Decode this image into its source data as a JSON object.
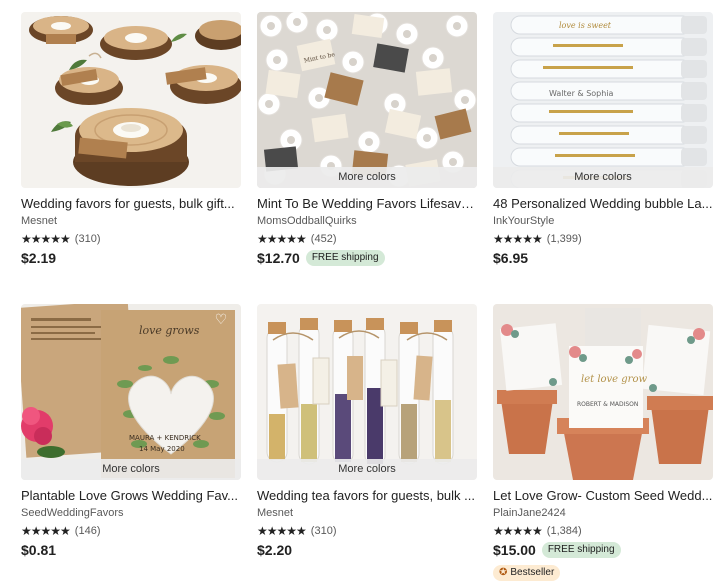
{
  "listings": [
    {
      "title": "Wedding favors for guests, bulk gift...",
      "shop": "Mesnet",
      "stars": "★★★★★",
      "reviews": "(310)",
      "price": "$2.19",
      "more_colors": "",
      "shipping": "",
      "badge": ""
    },
    {
      "title": "Mint To Be Wedding Favors Lifesave...",
      "shop": "MomsOddballQuirks",
      "stars": "★★★★★",
      "reviews": "(452)",
      "price": "$12.70",
      "more_colors": "More colors",
      "shipping": "FREE shipping",
      "badge": ""
    },
    {
      "title": "48 Personalized Wedding bubble La...",
      "shop": "InkYourStyle",
      "stars": "★★★★★",
      "reviews": "(1,399)",
      "price": "$6.95",
      "more_colors": "More colors",
      "shipping": "",
      "badge": ""
    },
    {
      "title": "Plantable Love Grows Wedding Fav...",
      "shop": "SeedWeddingFavors",
      "stars": "★★★★★",
      "reviews": "(146)",
      "price": "$0.81",
      "more_colors": "More colors",
      "shipping": "",
      "badge": ""
    },
    {
      "title": "Wedding tea favors for guests, bulk ...",
      "shop": "Mesnet",
      "stars": "★★★★★",
      "reviews": "(310)",
      "price": "$2.20",
      "more_colors": "More colors",
      "shipping": "",
      "badge": ""
    },
    {
      "title": "Let Love Grow- Custom Seed Wedd...",
      "shop": "PlainJane2424",
      "stars": "★★★★★",
      "reviews": "(1,384)",
      "price": "$15.00",
      "more_colors": "",
      "shipping": "FREE shipping",
      "badge": "Bestseller"
    }
  ],
  "image_text": {
    "mint": "Mint to be",
    "bubble": "love is sweet",
    "bubble_names": "Walter & Sophia",
    "seed_card_title": "love grows",
    "seed_card_names": "MAURA + KENDRICK",
    "seed_card_date": "14 May 2020",
    "pot_tag": "let love grow",
    "pot_names": "ROBERT & MADISON"
  },
  "icons": {
    "favorite": "heart-outline-icon",
    "bestseller": "award-icon"
  },
  "colors": {
    "free_shipping_bg": "#d4e9d7",
    "bestseller_bg": "#fdebd2",
    "text": "#222222"
  }
}
